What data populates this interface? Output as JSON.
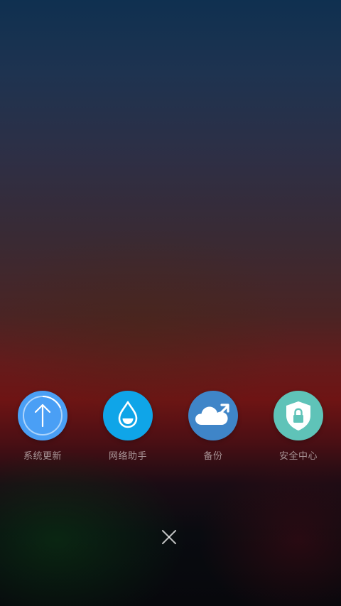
{
  "dock": {
    "items": [
      {
        "label": "系统更新",
        "icon": "system-update-icon",
        "color": "#4a9ff5"
      },
      {
        "label": "网络助手",
        "icon": "network-assistant-icon",
        "color": "#0fa5e8"
      },
      {
        "label": "备份",
        "icon": "cloud-backup-icon",
        "color": "#3f85c8"
      },
      {
        "label": "安全中心",
        "icon": "security-center-icon",
        "color": "#5fc3b8"
      }
    ]
  },
  "close": {
    "icon": "close-icon"
  },
  "footer": {
    "hint": ""
  }
}
